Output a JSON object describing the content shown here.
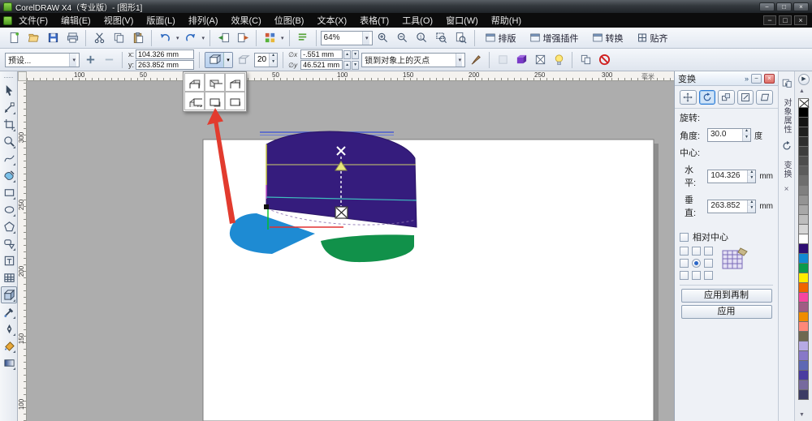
{
  "window": {
    "title": "CorelDRAW X4（专业版）- [图形1]",
    "controls": {
      "minimize": "−",
      "maximize": "□",
      "close": "×"
    }
  },
  "menubar": {
    "items": [
      "文件(F)",
      "编辑(E)",
      "视图(V)",
      "版面(L)",
      "排列(A)",
      "效果(C)",
      "位图(B)",
      "文本(X)",
      "表格(T)",
      "工具(O)",
      "窗口(W)",
      "帮助(H)"
    ],
    "doc_controls": {
      "minimize": "−",
      "restore": "□",
      "close": "×"
    }
  },
  "toolbar": {
    "zoom_level": "64%",
    "icon_buttons": [
      "new",
      "open",
      "save",
      "print",
      "cut",
      "copy",
      "paste",
      "undo",
      "redo",
      "import",
      "export",
      "launcher",
      "options",
      "zoom-in",
      "zoom-out",
      "zoom-one",
      "zoom-selected",
      "zoom-page"
    ],
    "labeled_buttons": [
      "排版",
      "增强插件",
      "转换",
      "贴齐"
    ]
  },
  "property_bar": {
    "preset_label": "预设...",
    "x_label": "x:",
    "x_value": "104.326 mm",
    "y_label": "y:",
    "y_value": "263.852 mm",
    "depth_value": "20",
    "vp_x_label": "∅x",
    "vp_x_value": "-.551 mm",
    "vp_y_label": "∅y",
    "vp_y_value": "46.521 mm",
    "vp_mode": "锁到对象上的灭点"
  },
  "rulers": {
    "horizontal_numbers": [
      "100",
      "50",
      "50",
      "100",
      "150",
      "200",
      "250",
      "300"
    ],
    "horizontal_unit": "毫米",
    "vertical_numbers": [
      "300",
      "250",
      "200",
      "150",
      "100"
    ]
  },
  "toolbox": {
    "tools": [
      {
        "name": "pick-tool",
        "icon": "tool-pick",
        "flyout": false,
        "selected": false
      },
      {
        "name": "shape-tool",
        "icon": "tool-shape",
        "flyout": true,
        "selected": false
      },
      {
        "name": "crop-tool",
        "icon": "tool-crop",
        "flyout": true,
        "selected": false
      },
      {
        "name": "zoom-tool",
        "icon": "tool-zoom",
        "flyout": true,
        "selected": false
      },
      {
        "name": "freehand-tool",
        "icon": "tool-curve",
        "flyout": true,
        "selected": false
      },
      {
        "name": "smart-fill-tool",
        "icon": "tool-smartfill",
        "flyout": true,
        "selected": false
      },
      {
        "name": "rectangle-tool",
        "icon": "tool-rect",
        "flyout": true,
        "selected": false
      },
      {
        "name": "ellipse-tool",
        "icon": "tool-ellipse",
        "flyout": true,
        "selected": false
      },
      {
        "name": "polygon-tool",
        "icon": "tool-poly",
        "flyout": true,
        "selected": false
      },
      {
        "name": "basic-shapes-tool",
        "icon": "tool-basic",
        "flyout": true,
        "selected": false
      },
      {
        "name": "text-tool",
        "icon": "tool-text",
        "flyout": false,
        "selected": false
      },
      {
        "name": "table-tool",
        "icon": "tool-table",
        "flyout": false,
        "selected": false
      },
      {
        "name": "extrude-tool",
        "icon": "tool-extrude",
        "flyout": true,
        "selected": true
      },
      {
        "name": "eyedropper-tool",
        "icon": "tool-eyedrop",
        "flyout": true,
        "selected": false
      },
      {
        "name": "outline-pen-tool",
        "icon": "tool-outline",
        "flyout": true,
        "selected": false
      },
      {
        "name": "fill-tool",
        "icon": "tool-fill",
        "flyout": true,
        "selected": false
      },
      {
        "name": "interactive-fill-tool",
        "icon": "tool-ifill",
        "flyout": true,
        "selected": false
      }
    ]
  },
  "flyout": {
    "items": [
      "extrusion-small-back",
      "extrusion-big-back",
      "extrusion-back-parallel",
      "extrusion-big-front",
      "extrusion-small-front",
      "extrusion-front-parallel"
    ]
  },
  "docker": {
    "title": "变换",
    "tabs": [
      {
        "name": "position-tab",
        "icon": "tab-move",
        "selected": false
      },
      {
        "name": "rotation-tab",
        "icon": "tab-rotate",
        "selected": true
      },
      {
        "name": "scale-mirror-tab",
        "icon": "tab-scale",
        "selected": false
      },
      {
        "name": "size-tab",
        "icon": "tab-size",
        "selected": false
      },
      {
        "name": "skew-tab",
        "icon": "tab-skew",
        "selected": false
      }
    ],
    "rotation_label": "旋转:",
    "angle_label": "角度:",
    "angle_value": "30.0",
    "angle_unit": "度",
    "center_label": "中心:",
    "h_label": "水平:",
    "h_value": "104.326",
    "h_unit": "mm",
    "v_label": "垂直:",
    "v_value": "263.852",
    "v_unit": "mm",
    "relative_center_label": "相对中心",
    "apply_duplicate_label": "应用到再制",
    "apply_label": "应用"
  },
  "side_tabs": {
    "items": [
      "对象属性",
      "变换"
    ],
    "close": "×"
  },
  "palette": {
    "colors": [
      "none",
      "#000000",
      "#141414",
      "#1f1f1f",
      "#2e2e2e",
      "#3d3d3d",
      "#4d4d4d",
      "#5c5c5c",
      "#6e6e6e",
      "#808080",
      "#949494",
      "#a8a8a8",
      "#bdbdbd",
      "#d6d6d6",
      "#ffffff",
      "#2e0d73",
      "#1289d3",
      "#0c9a4a",
      "#ffec00",
      "#f06400",
      "#f646a0",
      "#a05c84",
      "#f08c00",
      "#ff8878",
      "#6e6850",
      "#b6aae4",
      "#8878c8",
      "#5e68b4",
      "#4a3ca0",
      "#776a9e",
      "#3c3c64"
    ]
  },
  "drawing": {
    "slab_color": "#351c7d",
    "blue_slice_color": "#1e8bd3",
    "green_slice_color": "#11914a",
    "annotation_arrow_color": "#e23b2e"
  }
}
